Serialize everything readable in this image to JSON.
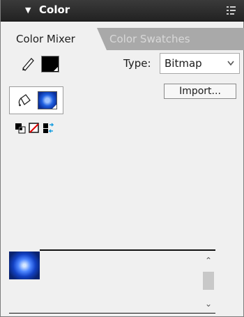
{
  "panel": {
    "title": "Color",
    "collapse_glyph": "▼",
    "menu_icon": "panel-menu-icon"
  },
  "tabs": [
    {
      "label": "Color Mixer",
      "active": true
    },
    {
      "label": "Color Swatches",
      "active": false
    }
  ],
  "stroke": {
    "icon": "pencil-icon",
    "color": "#000000"
  },
  "fill": {
    "icon": "paint-bucket-icon",
    "style": "bitmap-swatch"
  },
  "type": {
    "label": "Type:",
    "selected": "Bitmap"
  },
  "import_button": "Import...",
  "mini_tools": [
    "black-white-icon",
    "no-color-icon",
    "swap-colors-icon"
  ],
  "scroll": {
    "up": "⌃",
    "down": "⌄"
  }
}
